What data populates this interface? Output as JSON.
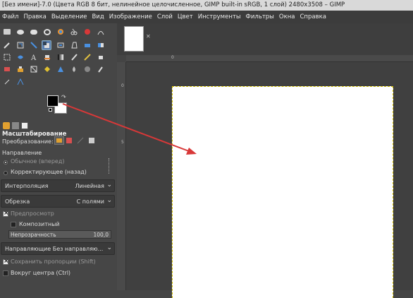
{
  "window": {
    "title": "[Без имени]-7.0 (Цвета RGB 8 бит, нелинейное целочисленное, GIMP built-in sRGB, 1 слой) 2480x3508 – GIMP"
  },
  "menu": [
    "Файл",
    "Правка",
    "Выделение",
    "Вид",
    "Изображение",
    "Слой",
    "Цвет",
    "Инструменты",
    "Фильтры",
    "Окна",
    "Справка"
  ],
  "colors": {
    "accent": "#d83838",
    "foreground": "#000000",
    "background": "#ffffff",
    "marching_ants": "#d8c400"
  },
  "tool_options": {
    "title": "Масштабирование",
    "transform_label": "Преобразование:",
    "direction_label": "Направление",
    "direction_normal": "Обычное (вперед)",
    "direction_corrective": "Корректирующее (назад)",
    "interpolation_label": "Интерполяция",
    "interpolation_value": "Линейная",
    "clipping_label": "Обрезка",
    "clipping_value": "С полями",
    "preview_label": "Предпросмотр",
    "composite_label": "Композитный",
    "opacity_label": "Непрозрачность",
    "opacity_value": "100,0",
    "guides_value": "Направляющие Без направляю...",
    "keep_aspect_label": "Сохранить пропорции  (Shift)",
    "around_center_label": "Вокруг центра (Ctrl)"
  },
  "ruler": {
    "h0": "0",
    "v0": "0",
    "v5": "5"
  }
}
